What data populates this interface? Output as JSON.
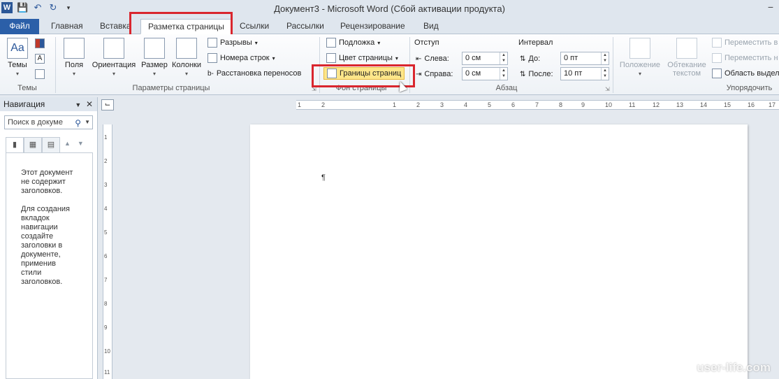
{
  "titlebar": {
    "title": "Документ3  -  Microsoft Word (Сбой активации продукта)",
    "logo": "W",
    "qat_icons": [
      "save-icon",
      "undo-icon",
      "redo-icon",
      "customize-icon"
    ]
  },
  "tabs": {
    "file": "Файл",
    "home": "Главная",
    "insert": "Вставка",
    "layout": "Разметка страницы",
    "references": "Ссылки",
    "mailings": "Рассылки",
    "review": "Рецензирование",
    "view": "Вид"
  },
  "ribbon": {
    "themes": {
      "label": "Темы",
      "group": "Темы"
    },
    "page_setup": {
      "group": "Параметры страницы",
      "margins": "Поля",
      "orientation": "Ориентация",
      "size": "Размер",
      "columns": "Колонки",
      "breaks": "Разрывы",
      "line_numbers": "Номера строк",
      "hyphenation": "Расстановка переносов"
    },
    "page_background": {
      "group": "Фон страницы",
      "watermark": "Подложка",
      "page_color": "Цвет страницы",
      "page_borders": "Границы страниц"
    },
    "paragraph": {
      "group": "Абзац",
      "indent": "Отступ",
      "left_label": "Слева:",
      "left_value": "0 см",
      "right_label": "Справа:",
      "right_value": "0 см",
      "spacing": "Интервал",
      "before_label": "До:",
      "before_value": "0 пт",
      "after_label": "После:",
      "after_value": "10 пт"
    },
    "arrange": {
      "group": "Упорядочить",
      "position": "Положение",
      "wrap_line1": "Обтекание",
      "wrap_line2": "текстом",
      "bring_forward": "Переместить в",
      "send_backward": "Переместить н",
      "selection_pane": "Область выдел"
    }
  },
  "navigation": {
    "title": "Навигация",
    "search_placeholder": "Поиск в докуме",
    "message1": "Этот документ\nне содержит\nзаголовков.",
    "message2": "Для создания\nвкладок\nнавигации\nсоздайте\nзаголовки в\nдокументе,\nприменив\nстили\nзаголовков."
  },
  "ruler": {
    "ticks": [
      "1",
      "2",
      "1",
      "2",
      "3",
      "4",
      "5",
      "6",
      "7",
      "8",
      "9",
      "10",
      "11",
      "12",
      "13",
      "14",
      "15",
      "16",
      "17"
    ],
    "vticks": [
      "1",
      "2",
      "3",
      "4",
      "5",
      "6",
      "7",
      "8",
      "9",
      "10",
      "11"
    ]
  },
  "document": {
    "pilcrow": "¶"
  },
  "watermark": "user-life.com"
}
